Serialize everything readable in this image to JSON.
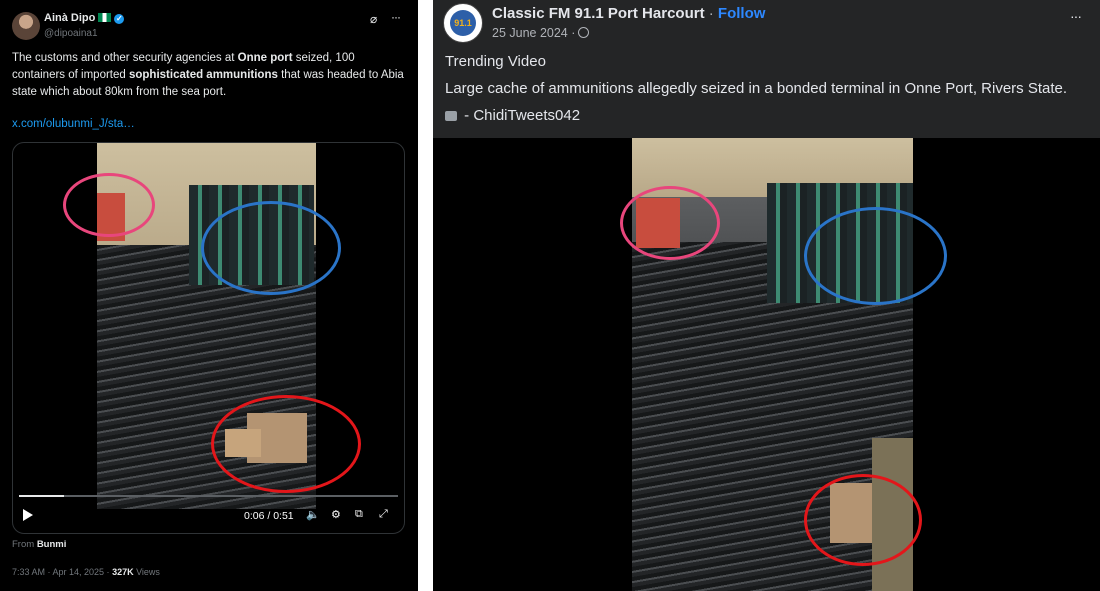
{
  "left_post": {
    "author_name": "Ainà Dipo",
    "handle": "@dipoaina1",
    "text_parts": {
      "p1": "The customs and other security agencies at ",
      "b1": "Onne port",
      "p2": " seized, 100 containers of imported ",
      "b2": "sophisticated ammunitions",
      "p3": " that was headed to Abia state which about 80km from the sea port."
    },
    "link": "x.com/olubunmi_J/sta…",
    "video": {
      "time": "0:06 / 0:51",
      "progress_fraction": 0.12
    },
    "from_label": "From",
    "from_name": "Bunmi",
    "meta_time": "7:33 AM · Apr 14, 2025 · ",
    "views_count": "327K",
    "views_label": " Views"
  },
  "right_post": {
    "page_name": "Classic FM 91.1 Port Harcourt",
    "separator": " · ",
    "follow_label": "Follow",
    "date": "25 June 2024 ·",
    "avatar_text": "91.1",
    "line1": "Trending Video",
    "line2": "Large cache of ammunitions allegedly seized in a bonded terminal in Onne Port, Rivers State.",
    "line3": " - ChidiTweets042"
  },
  "colors": {
    "x_link": "#1d9bf0",
    "fb_follow": "#2d88ff",
    "circle_pink": "#e8467c",
    "circle_blue": "#2a74c8",
    "circle_red": "#e3161a"
  },
  "icons": [
    "verified-badge-icon",
    "nigeria-flag-icon",
    "grok-icon",
    "more-icon",
    "play-icon",
    "volume-icon",
    "settings-icon",
    "pip-icon",
    "fullscreen-icon",
    "globe-icon",
    "video-icon"
  ]
}
